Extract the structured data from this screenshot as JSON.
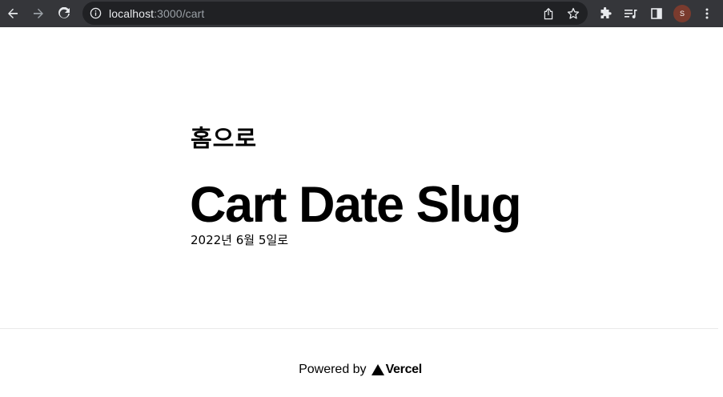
{
  "browser": {
    "url_host": "localhost",
    "url_path": ":3000/cart",
    "profile_initial": "S",
    "icons": {
      "back": "arrow-left",
      "forward": "arrow-right",
      "reload": "reload",
      "site_info": "info-circle",
      "share": "share-box",
      "bookmark": "star-outline",
      "extensions": "puzzle-piece",
      "media": "media-queue",
      "side_panel": "side-panel",
      "menu": "three-dots-vertical"
    },
    "colors": {
      "toolbar": "#35363a",
      "omnibox": "#202124",
      "avatar": "#7a3b2e"
    }
  },
  "page": {
    "home_link": "홈으로",
    "title": "Cart Date Slug",
    "date": "2022년 6월 5일로"
  },
  "footer": {
    "powered_by": "Powered by",
    "brand": "Vercel"
  }
}
